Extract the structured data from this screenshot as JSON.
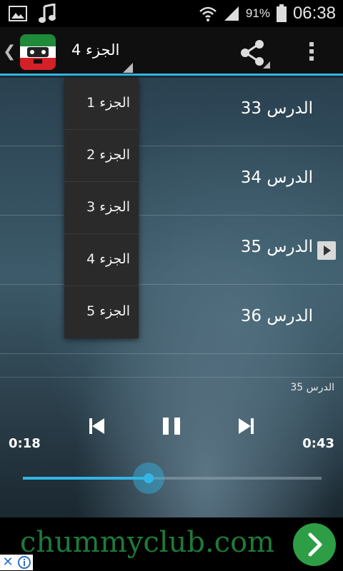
{
  "status_bar": {
    "battery_percent": "91%",
    "time": "06:38",
    "icons": [
      "image-icon",
      "music-note-icon",
      "wifi-icon",
      "signal-icon",
      "battery-icon"
    ]
  },
  "action_bar": {
    "selected_part": "الجزء 4",
    "icons": [
      "chevron-left-icon",
      "app-icon",
      "share-icon",
      "overflow-menu-icon"
    ],
    "accent_color": "#33b5e5"
  },
  "dropdown": {
    "items": [
      "الجزء 1",
      "الجزء 2",
      "الجزء 3",
      "الجزء 4",
      "الجزء 5"
    ]
  },
  "lessons": [
    {
      "label": "الدرس 33",
      "playing": false
    },
    {
      "label": "الدرس 34",
      "playing": false
    },
    {
      "label": "الدرس 35",
      "playing": true
    },
    {
      "label": "الدرس 36",
      "playing": false
    }
  ],
  "player": {
    "now_playing": "الدرس 35",
    "elapsed": "0:18",
    "total": "0:43",
    "progress_fraction": 0.42,
    "icons": [
      "skip-previous-icon",
      "pause-icon",
      "skip-next-icon"
    ]
  },
  "ad": {
    "text": "chummyclub.com",
    "icons": [
      "close-icon",
      "info-icon",
      "arrow-right-icon"
    ],
    "color": "#2e9e46"
  }
}
